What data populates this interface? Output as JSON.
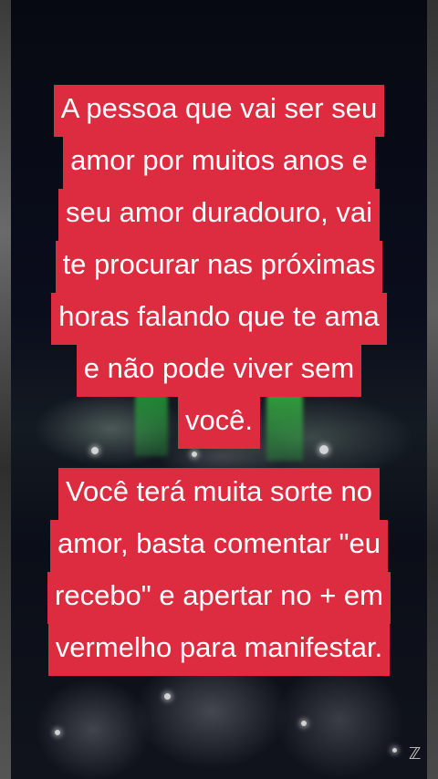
{
  "message_top": {
    "lines": [
      "A pessoa que vai ser seu",
      "amor por muitos anos e",
      "seu amor duradouro, vai",
      "te procurar nas próximas",
      "horas falando que te ama",
      "e não pode viver sem",
      "você."
    ]
  },
  "message_bottom": {
    "lines": [
      "Você terá muita sorte no",
      "amor, basta comentar \"eu",
      "recebo\" e apertar no + em",
      "vermelho para manifestar."
    ]
  },
  "watermark": "ℤ",
  "colors": {
    "caption_bg": "#dd2c40",
    "caption_text": "#ffffff",
    "laser_green": "#34c24a"
  }
}
